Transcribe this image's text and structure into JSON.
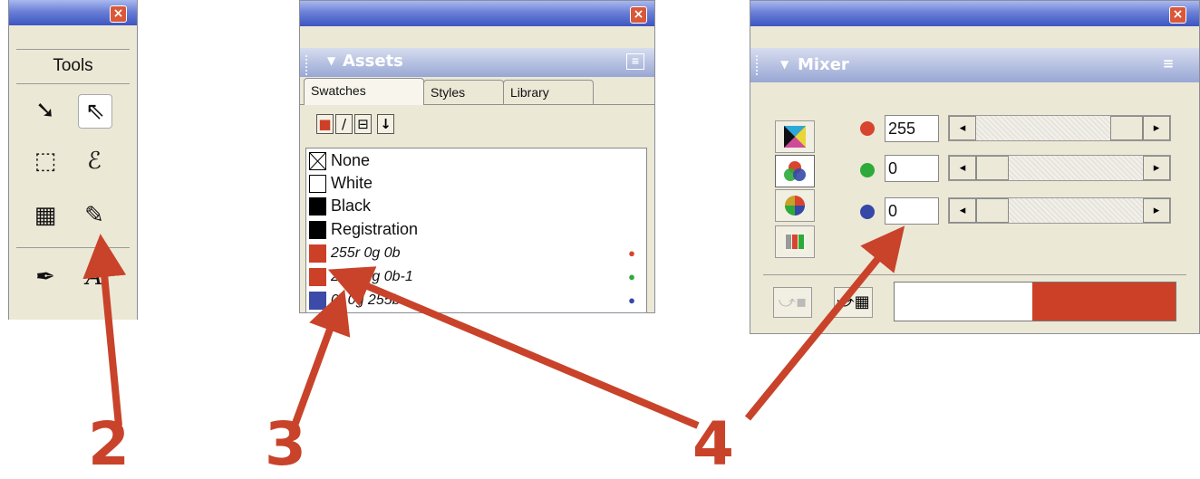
{
  "tools_panel": {
    "title": "Tools",
    "close_label": "×",
    "tools": [
      "pointer-icon",
      "subselect-icon",
      "select-behind-icon",
      "lasso-icon",
      "scale-icon",
      "eyedropper-icon",
      "pen-icon",
      "text-icon"
    ],
    "tool_glyphs": [
      "➘",
      "⇖",
      "⬚",
      "ℰ",
      "▦",
      "✎",
      "✒",
      "A"
    ]
  },
  "assets_panel": {
    "title": "Assets",
    "close_label": "×",
    "menu_glyph": "≡",
    "tabs": [
      {
        "label": "Swatches",
        "active": true
      },
      {
        "label": "Styles",
        "active": false
      },
      {
        "label": "Library",
        "active": false
      }
    ],
    "toolbar_glyphs": [
      "■",
      "/",
      "⊟",
      "↓"
    ],
    "swatches": [
      {
        "name": "None",
        "color": "#ffffff",
        "style": "none",
        "italic": false,
        "rgb_marker": false
      },
      {
        "name": "White",
        "color": "#ffffff",
        "style": "solid",
        "italic": false,
        "rgb_marker": false
      },
      {
        "name": "Black",
        "color": "#000000",
        "style": "solid",
        "italic": false,
        "rgb_marker": false
      },
      {
        "name": "Registration",
        "color": "#000000",
        "style": "solid",
        "italic": false,
        "rgb_marker": false
      },
      {
        "name": "255r 0g 0b",
        "color": "#cc4028",
        "style": "solid",
        "italic": true,
        "rgb_marker": true
      },
      {
        "name": "255r 0g 0b-1",
        "color": "#cc4028",
        "style": "solid",
        "italic": true,
        "rgb_marker": true
      },
      {
        "name": "0r 0g 255b",
        "color": "#3c4aa8",
        "style": "solid",
        "italic": true,
        "rgb_marker": true
      }
    ]
  },
  "mixer_panel": {
    "title": "Mixer",
    "close_label": "×",
    "menu_glyph": "≡",
    "mode_buttons": [
      "cmyk-mode-icon",
      "rgb-mode-icon",
      "hsb-mode-icon",
      "grayscale-mode-icon"
    ],
    "channels": [
      {
        "name": "red",
        "color": "#d8452e",
        "value": "255"
      },
      {
        "name": "green",
        "color": "#2cab3a",
        "value": "0"
      },
      {
        "name": "blue",
        "color": "#3548a8",
        "value": "0"
      }
    ],
    "preview_old_color": "#ffffff",
    "preview_new_color": "#cc4028"
  },
  "annotations": {
    "labels": [
      "2",
      "3",
      "4"
    ],
    "arrow_color": "#c8432a"
  }
}
